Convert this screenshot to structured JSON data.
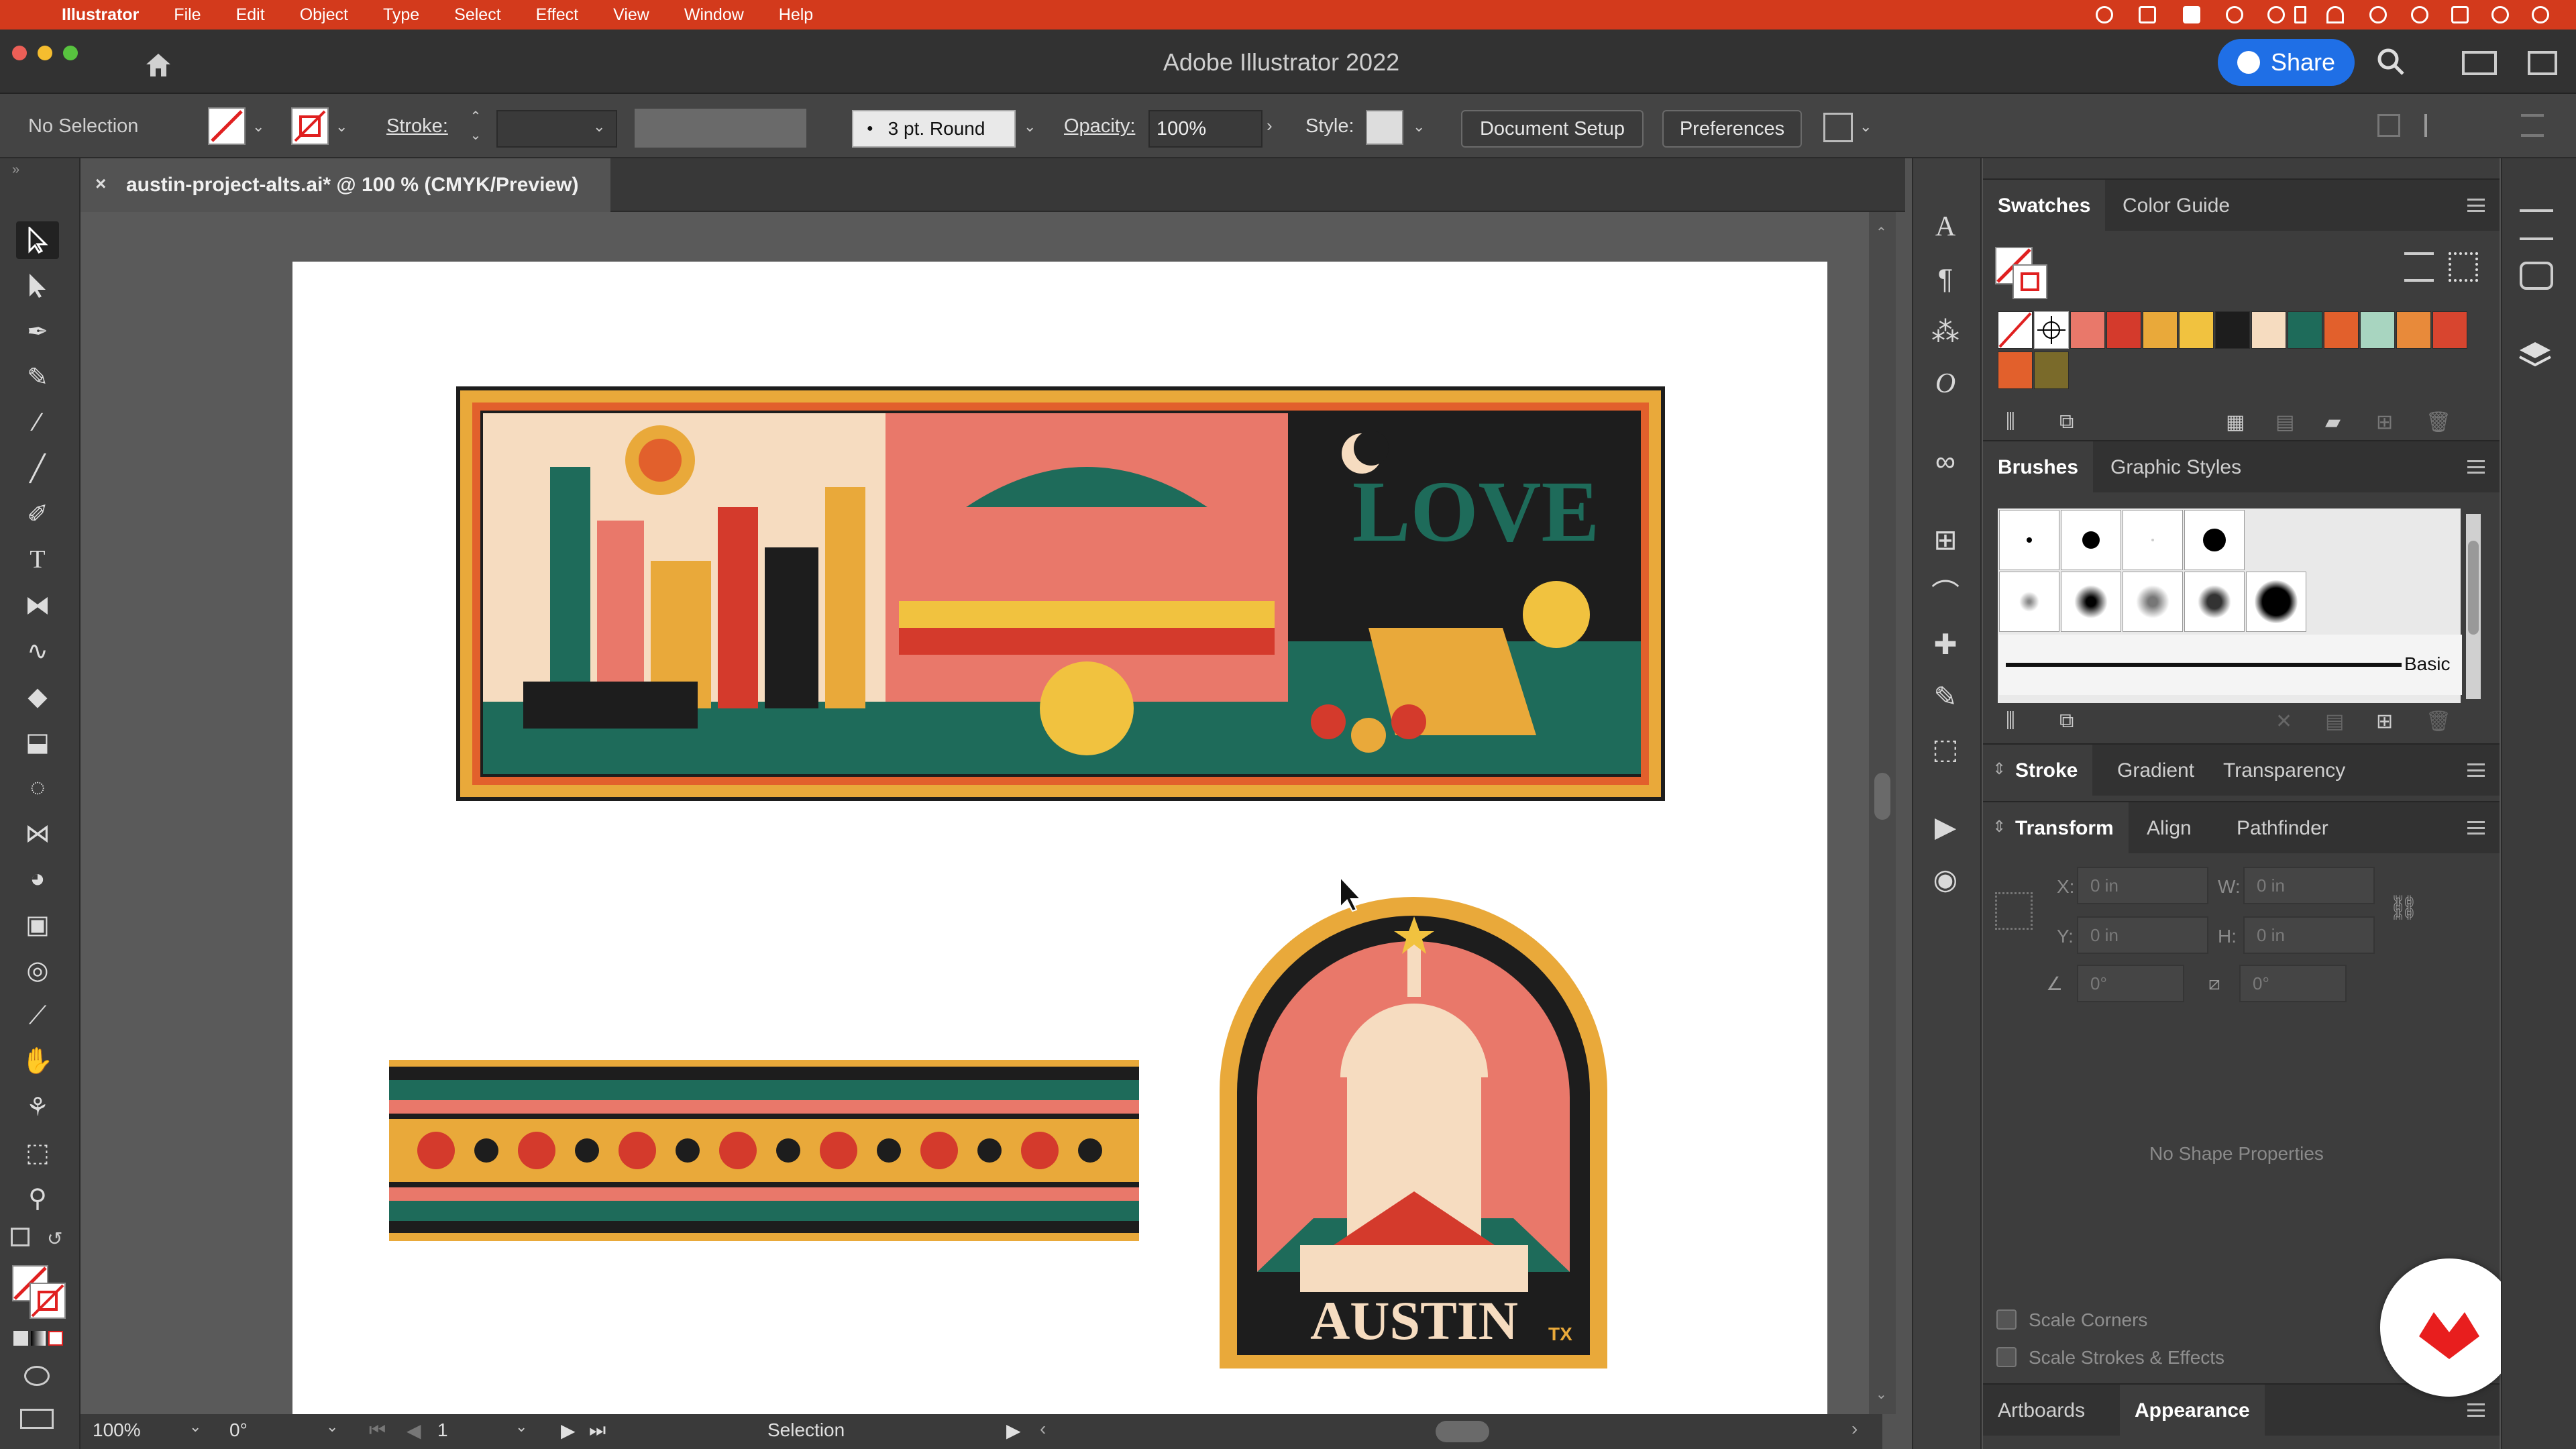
{
  "menubar": {
    "app": "Illustrator",
    "items": [
      "File",
      "Edit",
      "Object",
      "Type",
      "Select",
      "Effect",
      "View",
      "Window",
      "Help"
    ]
  },
  "window": {
    "title": "Adobe Illustrator 2022",
    "share": "Share"
  },
  "control": {
    "selection": "No Selection",
    "stroke_label": "Stroke:",
    "brush": "3 pt. Round",
    "opacity_label": "Opacity:",
    "opacity": "100%",
    "style_label": "Style:",
    "doc_setup": "Document Setup",
    "preferences": "Preferences"
  },
  "document": {
    "tab": "austin-project-alts.ai* @ 100 % (CMYK/Preview)"
  },
  "artwork": {
    "badge_text": "AUSTIN",
    "badge_small": "TX",
    "banner_word": "LOVE"
  },
  "status": {
    "zoom": "100%",
    "rotation": "0°",
    "page": "1",
    "tool": "Selection"
  },
  "panels": {
    "swatches": {
      "tabs": [
        "Swatches",
        "Color Guide"
      ],
      "colors": [
        "#e9786a",
        "#d43a2c",
        "#e9a93a",
        "#f1c23f",
        "#1d1d1d",
        "#f6dcc0",
        "#1e6b5a",
        "#e2602c",
        "#a8d5c0",
        "#e88a3a",
        "#d8452f",
        "#c9472d",
        "#e2602c",
        "#7a6a2a"
      ]
    },
    "brushes": {
      "tabs": [
        "Brushes",
        "Graphic Styles"
      ],
      "basic": "Basic"
    },
    "stroke": {
      "tabs": [
        "Stroke",
        "Gradient",
        "Transparency"
      ]
    },
    "transform": {
      "tabs": [
        "Transform",
        "Align",
        "Pathfinder"
      ],
      "x_label": "X:",
      "y_label": "Y:",
      "w_label": "W:",
      "h_label": "H:",
      "x": "0 in",
      "y": "0 in",
      "w": "0 in",
      "h": "0 in",
      "angle": "0°",
      "shear": "0°",
      "no_shape": "No Shape Properties",
      "scale_corners": "Scale Corners",
      "scale_strokes": "Scale Strokes & Effects"
    },
    "bottom": {
      "tabs": [
        "Artboards",
        "Appearance"
      ]
    }
  }
}
